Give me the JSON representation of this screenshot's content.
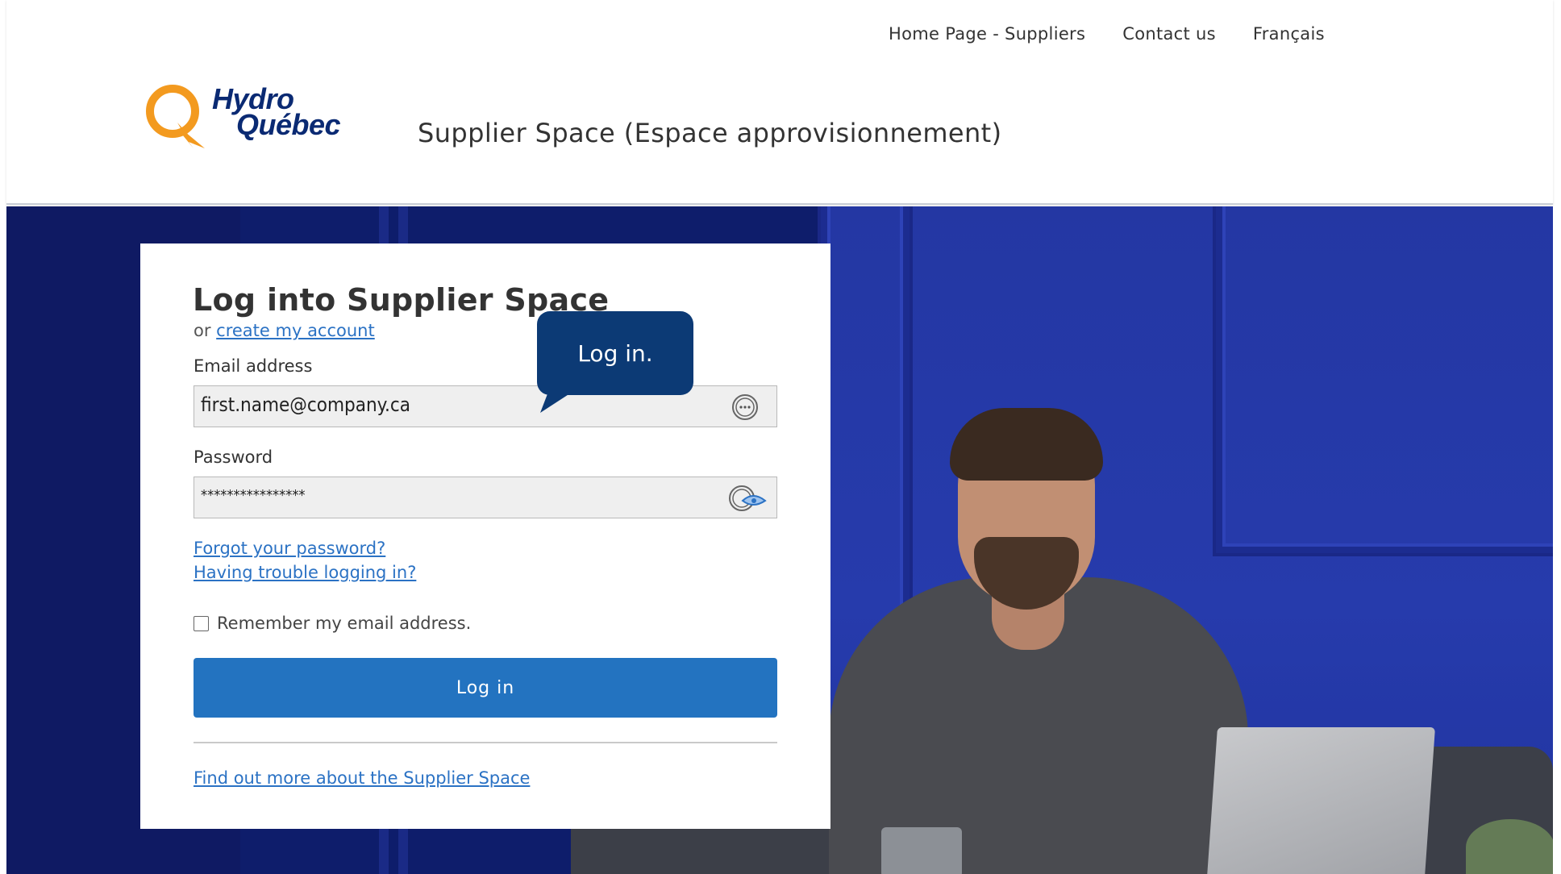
{
  "header": {
    "nav": [
      {
        "label": "Home Page - Suppliers"
      },
      {
        "label": "Contact us"
      },
      {
        "label": "Français"
      }
    ],
    "logo": {
      "line1": "Hydro",
      "line2": "Québec",
      "icon": "hydro-quebec-q-logo",
      "brand_orange": "#f39a1f",
      "brand_blue": "#0a2a73"
    },
    "site_title": "Supplier Space (Espace approvisionnement)"
  },
  "login": {
    "title": "Log into Supplier Space",
    "or_text": "or",
    "create_account": "create my account",
    "email": {
      "label": "Email address",
      "value": "first.name@company.ca",
      "icon": "more-options-icon"
    },
    "password": {
      "label": "Password",
      "value": "****************",
      "icon": "show-password-icon"
    },
    "forgot_password": "Forgot your password?",
    "trouble": "Having trouble logging in?",
    "remember": {
      "label": "Remember my email address.",
      "checked": false
    },
    "submit": "Log in",
    "find_out": "Find out more about the Supplier Space"
  },
  "callout": {
    "text": "Log in."
  },
  "colors": {
    "primary_button": "#2373c0",
    "link": "#2b72c4",
    "callout": "#0c3a75",
    "hero_wall": "#2437a3"
  }
}
